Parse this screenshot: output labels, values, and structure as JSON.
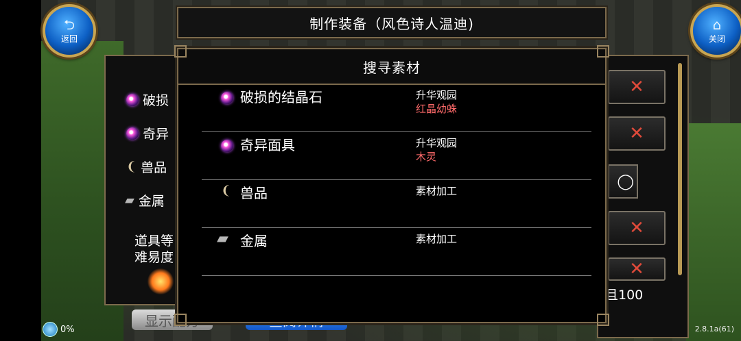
{
  "header": {
    "back_label": "返回",
    "close_label": "关闭",
    "title": "制作装备（风色诗人温迪)"
  },
  "background_panel": {
    "items": [
      {
        "icon": "purple-gem-icon",
        "label": "破损"
      },
      {
        "icon": "purple-gem-icon",
        "label": "奇异"
      },
      {
        "icon": "horn-icon",
        "label": "兽品"
      },
      {
        "icon": "metal-ingot-icon",
        "label": "金属"
      }
    ],
    "note_line1": "道具等",
    "note_line2": "难易度",
    "right_text": "且100"
  },
  "modal": {
    "title": "搜寻素材",
    "materials": [
      {
        "icon": "purple-gem-icon",
        "name": "破损的结晶石",
        "source_location": "升华观园",
        "source_enemy": "红晶幼蛛"
      },
      {
        "icon": "purple-gem-icon",
        "name": "奇异面具",
        "source_location": "升华观园",
        "source_enemy": "木灵"
      },
      {
        "icon": "horn-icon",
        "name": "兽品",
        "source_location": "素材加工",
        "source_enemy": ""
      },
      {
        "icon": "metal-ingot-icon",
        "name": "金属",
        "source_location": "素材加工",
        "source_enemy": ""
      }
    ]
  },
  "bottom": {
    "left_button": "显示配方",
    "mid_button": "查阅详情"
  },
  "status": {
    "progress": "0%",
    "version": "2.8.1a(61)"
  },
  "colors": {
    "enemy_text": "#ff6a6a",
    "frame_gold": "#7c6a4c",
    "round_button_blue": "#1a6fd4",
    "x_red": "#e04a3a"
  }
}
